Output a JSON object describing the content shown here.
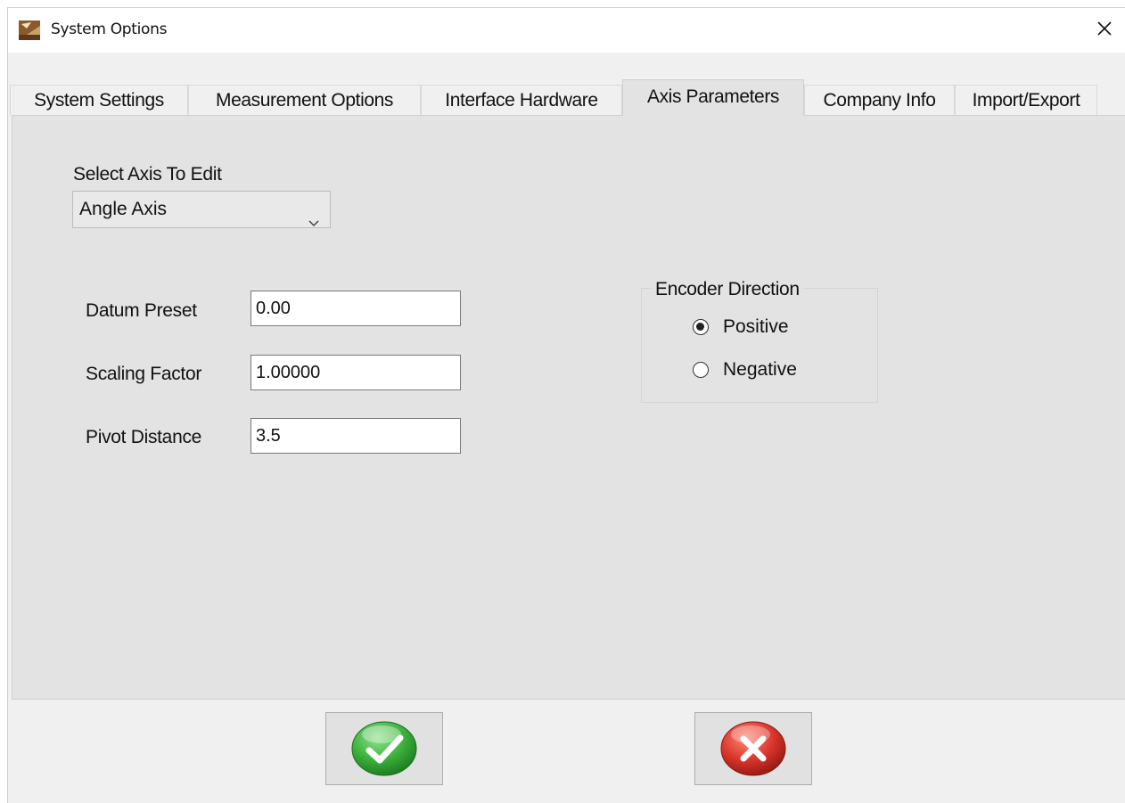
{
  "window": {
    "title": "System Options",
    "app_icon": "app-icon",
    "close_icon": "close-icon"
  },
  "tabs": [
    {
      "label": "System Settings",
      "active": false
    },
    {
      "label": "Measurement Options",
      "active": false
    },
    {
      "label": "Interface Hardware",
      "active": false
    },
    {
      "label": "Axis Parameters",
      "active": true
    },
    {
      "label": "Company Info",
      "active": false
    },
    {
      "label": "Import/Export",
      "active": false
    }
  ],
  "axis_select": {
    "label": "Select Axis To Edit",
    "value": "Angle Axis"
  },
  "fields": {
    "datum_preset": {
      "label": "Datum Preset",
      "value": "0.00"
    },
    "scaling_factor": {
      "label": "Scaling Factor",
      "value": "1.00000"
    },
    "pivot_distance": {
      "label": "Pivot Distance",
      "value": "3.5"
    }
  },
  "encoder_direction": {
    "title": "Encoder Direction",
    "options": [
      {
        "label": "Positive",
        "selected": true
      },
      {
        "label": "Negative",
        "selected": false
      }
    ]
  },
  "buttons": {
    "ok_icon": "green-checkmark-icon",
    "cancel_icon": "red-x-icon"
  },
  "colors": {
    "ok_green": "#3bb03b",
    "cancel_red": "#d9352b",
    "panel_bg": "#e3e3e3"
  }
}
